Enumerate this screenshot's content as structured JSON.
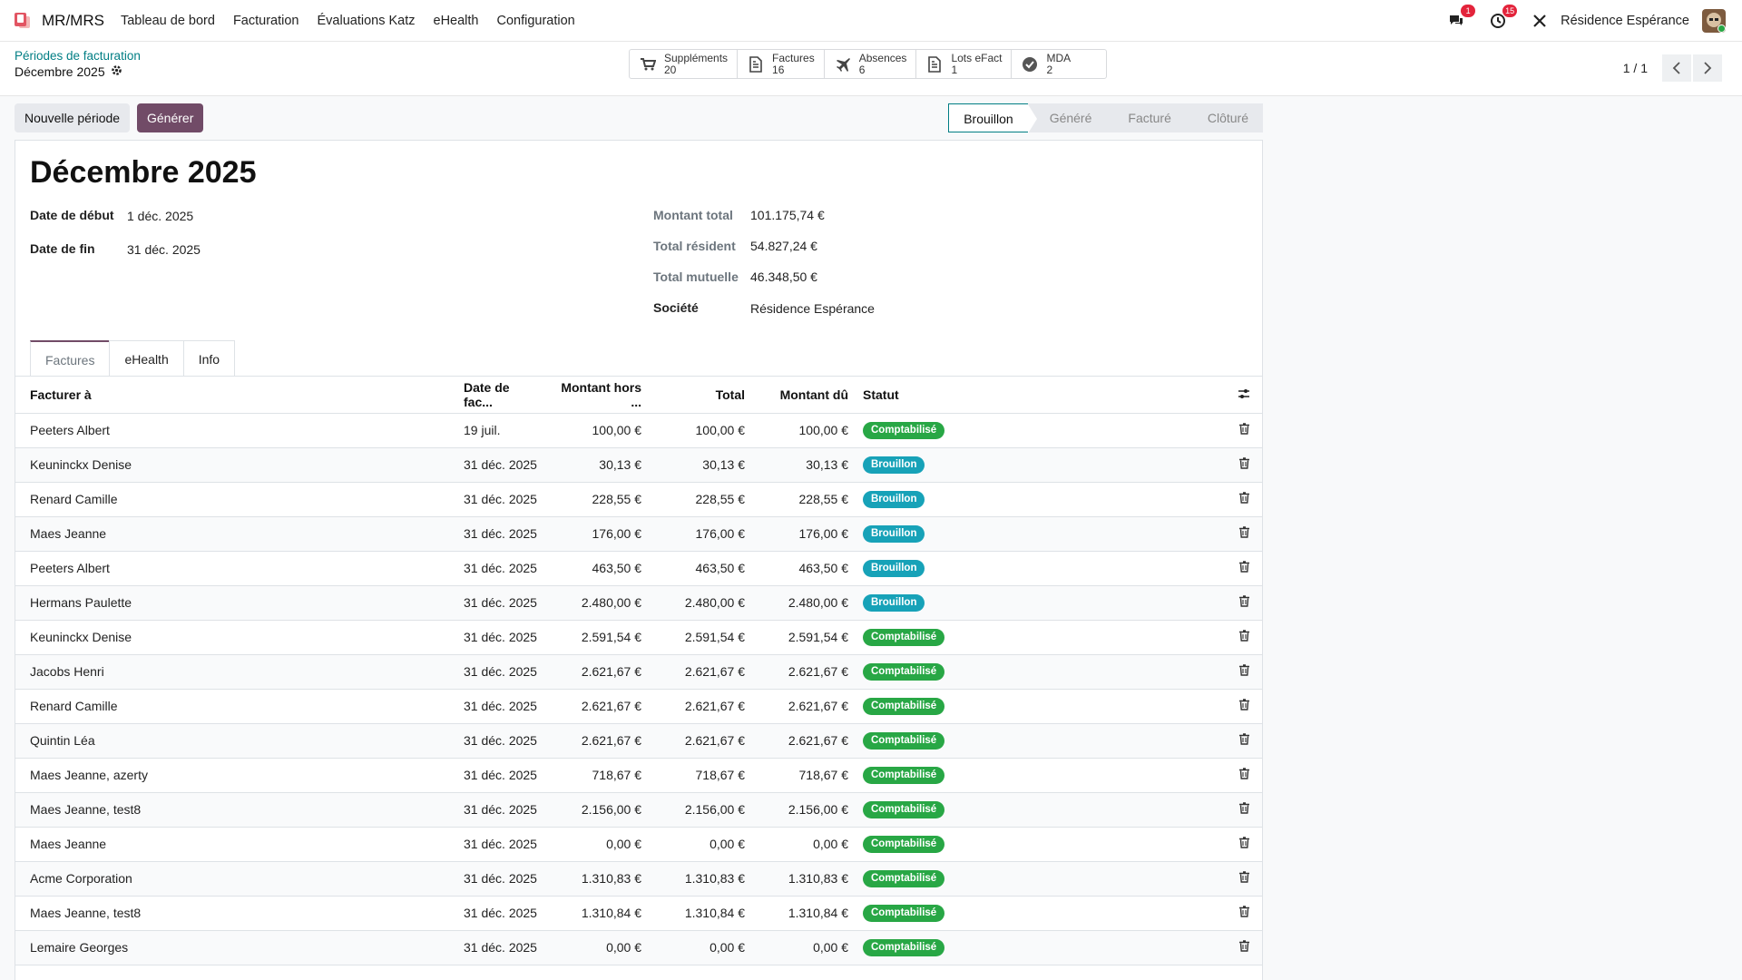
{
  "navbar": {
    "brand": "MR/MRS",
    "menu": [
      "Tableau de bord",
      "Facturation",
      "Évaluations Katz",
      "eHealth",
      "Configuration"
    ],
    "messages_count": "1",
    "activities_count": "15",
    "company": "Résidence Espérance"
  },
  "breadcrumb": {
    "parent": "Périodes de facturation",
    "current": "Décembre 2025"
  },
  "smart_buttons": [
    {
      "icon": "cart-icon",
      "label": "Suppléments",
      "value": "20"
    },
    {
      "icon": "file-icon",
      "label": "Factures",
      "value": "16"
    },
    {
      "icon": "plane-icon",
      "label": "Absences",
      "value": "6"
    },
    {
      "icon": "file-icon",
      "label": "Lots eFact",
      "value": "1"
    },
    {
      "icon": "check-circle-icon",
      "label": "MDA",
      "value": "2"
    }
  ],
  "pager": {
    "value": "1 / 1"
  },
  "actions": {
    "new_period": "Nouvelle période",
    "generate": "Générer"
  },
  "stages": [
    "Brouillon",
    "Généré",
    "Facturé",
    "Clôturé"
  ],
  "record": {
    "title": "Décembre 2025",
    "start_label": "Date de début",
    "start_value": "1 déc. 2025",
    "end_label": "Date de fin",
    "end_value": "31 déc. 2025",
    "total_label": "Montant total",
    "total_value": "101.175,74 €",
    "resident_label": "Total résident",
    "resident_value": "54.827,24 €",
    "mutual_label": "Total mutuelle",
    "mutual_value": "46.348,50 €",
    "company_label": "Société",
    "company_value": "Résidence Espérance"
  },
  "tabs": [
    "Factures",
    "eHealth",
    "Info"
  ],
  "table": {
    "headers": [
      "Facturer à",
      "Date de fac...",
      "Montant hors ...",
      "Total",
      "Montant dû",
      "Statut"
    ],
    "status_colors": {
      "Comptabilisé": "#28a745",
      "Brouillon": "#17a2b8"
    },
    "rows": [
      [
        "Peeters Albert",
        "19 juil.",
        "100,00 €",
        "100,00 €",
        "100,00 €",
        "Comptabilisé"
      ],
      [
        "Keuninckx Denise",
        "31 déc. 2025",
        "30,13 €",
        "30,13 €",
        "30,13 €",
        "Brouillon"
      ],
      [
        "Renard Camille",
        "31 déc. 2025",
        "228,55 €",
        "228,55 €",
        "228,55 €",
        "Brouillon"
      ],
      [
        "Maes Jeanne",
        "31 déc. 2025",
        "176,00 €",
        "176,00 €",
        "176,00 €",
        "Brouillon"
      ],
      [
        "Peeters Albert",
        "31 déc. 2025",
        "463,50 €",
        "463,50 €",
        "463,50 €",
        "Brouillon"
      ],
      [
        "Hermans Paulette",
        "31 déc. 2025",
        "2.480,00 €",
        "2.480,00 €",
        "2.480,00 €",
        "Brouillon"
      ],
      [
        "Keuninckx Denise",
        "31 déc. 2025",
        "2.591,54 €",
        "2.591,54 €",
        "2.591,54 €",
        "Comptabilisé"
      ],
      [
        "Jacobs Henri",
        "31 déc. 2025",
        "2.621,67 €",
        "2.621,67 €",
        "2.621,67 €",
        "Comptabilisé"
      ],
      [
        "Renard Camille",
        "31 déc. 2025",
        "2.621,67 €",
        "2.621,67 €",
        "2.621,67 €",
        "Comptabilisé"
      ],
      [
        "Quintin Léa",
        "31 déc. 2025",
        "2.621,67 €",
        "2.621,67 €",
        "2.621,67 €",
        "Comptabilisé"
      ],
      [
        "Maes Jeanne, azerty",
        "31 déc. 2025",
        "718,67 €",
        "718,67 €",
        "718,67 €",
        "Comptabilisé"
      ],
      [
        "Maes Jeanne, test8",
        "31 déc. 2025",
        "2.156,00 €",
        "2.156,00 €",
        "2.156,00 €",
        "Comptabilisé"
      ],
      [
        "Maes Jeanne",
        "31 déc. 2025",
        "0,00 €",
        "0,00 €",
        "0,00 €",
        "Comptabilisé"
      ],
      [
        "Acme Corporation",
        "31 déc. 2025",
        "1.310,83 €",
        "1.310,83 €",
        "1.310,83 €",
        "Comptabilisé"
      ],
      [
        "Maes Jeanne, test8",
        "31 déc. 2025",
        "1.310,84 €",
        "1.310,84 €",
        "1.310,84 €",
        "Comptabilisé"
      ],
      [
        "Lemaire Georges",
        "31 déc. 2025",
        "0,00 €",
        "0,00 €",
        "0,00 €",
        "Comptabilisé"
      ]
    ]
  }
}
